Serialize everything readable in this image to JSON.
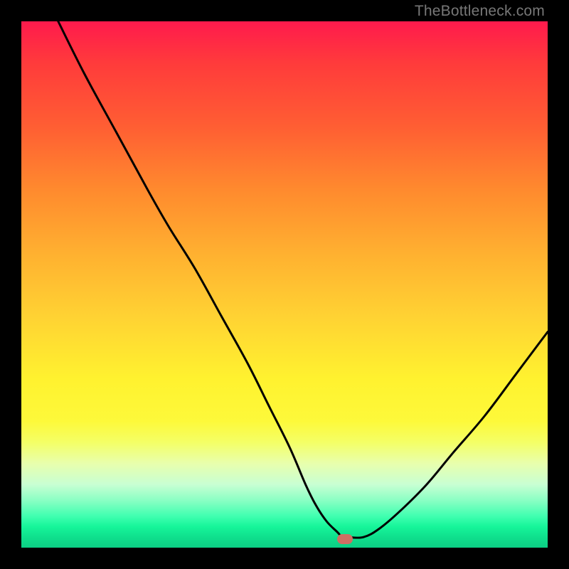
{
  "watermark": "TheBottleneck.com",
  "chart_data": {
    "type": "line",
    "title": "",
    "xlabel": "",
    "ylabel": "",
    "xlim": [
      0,
      100
    ],
    "ylim": [
      0,
      100
    ],
    "series": [
      {
        "name": "curve",
        "x": [
          7,
          12,
          18,
          24,
          28,
          33,
          38,
          43,
          47,
          51,
          54,
          56,
          58,
          60,
          61,
          62,
          65,
          68,
          72,
          77,
          82,
          88,
          94,
          100
        ],
        "y": [
          100,
          90,
          79,
          68,
          61,
          53,
          44,
          35,
          27,
          19,
          12,
          8,
          5,
          3,
          2,
          2,
          2,
          3.6,
          7,
          12,
          18,
          25,
          33,
          41
        ]
      }
    ],
    "marker": {
      "x": 61.5,
      "y": 1.6
    },
    "gradient_stops": [
      {
        "pos": 0,
        "color": "#ff1a4d"
      },
      {
        "pos": 20,
        "color": "#ff5e33"
      },
      {
        "pos": 44,
        "color": "#ffb030"
      },
      {
        "pos": 68,
        "color": "#fff22f"
      },
      {
        "pos": 88,
        "color": "#c8ffd3"
      },
      {
        "pos": 100,
        "color": "#0cce84"
      }
    ]
  }
}
